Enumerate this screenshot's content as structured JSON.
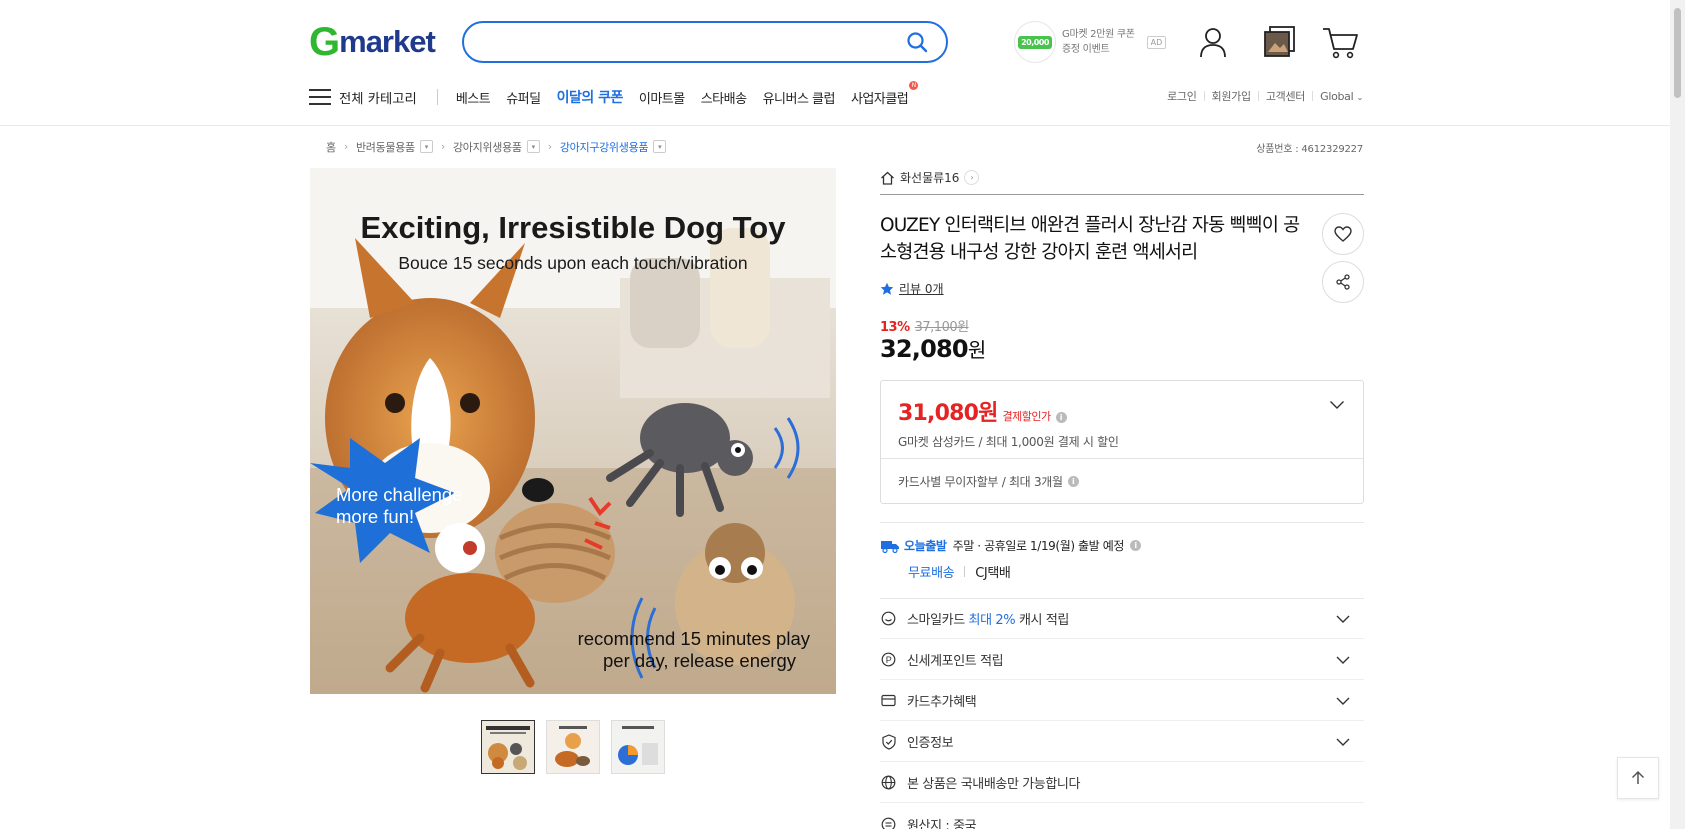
{
  "header": {
    "logo_g": "G",
    "logo_rest": "market",
    "search_placeholder": "",
    "ad": {
      "coin_amount": "20,000",
      "line1": "G마켓 2만원 쿠폰",
      "line2": "증정 이벤트",
      "badge": "AD"
    }
  },
  "nav": {
    "category_label": "전체 카테고리",
    "items": [
      "베스트",
      "슈퍼딜",
      "이달의 쿠폰",
      "이마트몰",
      "스타배송",
      "유니버스 클럽",
      "사업자클럽"
    ],
    "new_badge": "N",
    "util": [
      "로그인",
      "회원가입",
      "고객센터",
      "Global"
    ]
  },
  "breadcrumb": {
    "items": [
      "홈",
      "반려동물용품",
      "강아지위생용품",
      "강아지구강위생용품"
    ],
    "product_no": "상품번호 : 4612329227"
  },
  "image": {
    "headline": "Exciting, Irresistible Dog Toy",
    "subline": "Bouce 15 seconds upon each touch/vibration",
    "burst_line1": "More challenge",
    "burst_line2": "more fun!",
    "bottom_line1": "recommend 15 minutes play",
    "bottom_line2": "per day, release energy",
    "thumb_count": 3
  },
  "product": {
    "store": "화선물류16",
    "title": "OUZEY 인터랙티브 애완견 플러시 장난감 자동 삑삑이 공 소형견용 내구성 강한 강아지 훈련 액세서리",
    "review": "리뷰 0개",
    "discount_pct": "13%",
    "original_price": "37,100원",
    "price_num": "32,080",
    "price_won": "원"
  },
  "card_offer": {
    "price": "31,080원",
    "label": "결제할인가",
    "sub": "G마켓 삼성카드 / 최대 1,000원 결제 시 할인",
    "installment": "카드사별 무이자할부 / 최대 3개월"
  },
  "shipping": {
    "today": "오늘출발",
    "note": "주말 · 공휴일로 1/19(월) 출발 예정",
    "free": "무료배송",
    "carrier": "CJ택배"
  },
  "accordion": [
    {
      "pre": "스마일카드 ",
      "hl": "최대 2%",
      "post": " 캐시 적립"
    },
    {
      "pre": "신세계포인트 적립",
      "hl": "",
      "post": ""
    },
    {
      "pre": "카드추가혜택",
      "hl": "",
      "post": ""
    },
    {
      "pre": "인증정보",
      "hl": "",
      "post": ""
    },
    {
      "pre": "본 상품은 국내배송만 가능합니다",
      "hl": "",
      "post": ""
    },
    {
      "pre": "원산지 : 중국",
      "hl": "",
      "post": ""
    }
  ],
  "colors": {
    "brand_green": "#2fb72f",
    "brand_navy": "#1f3a8c",
    "accent_blue": "#1f6fe0",
    "sale_red": "#e52323"
  }
}
